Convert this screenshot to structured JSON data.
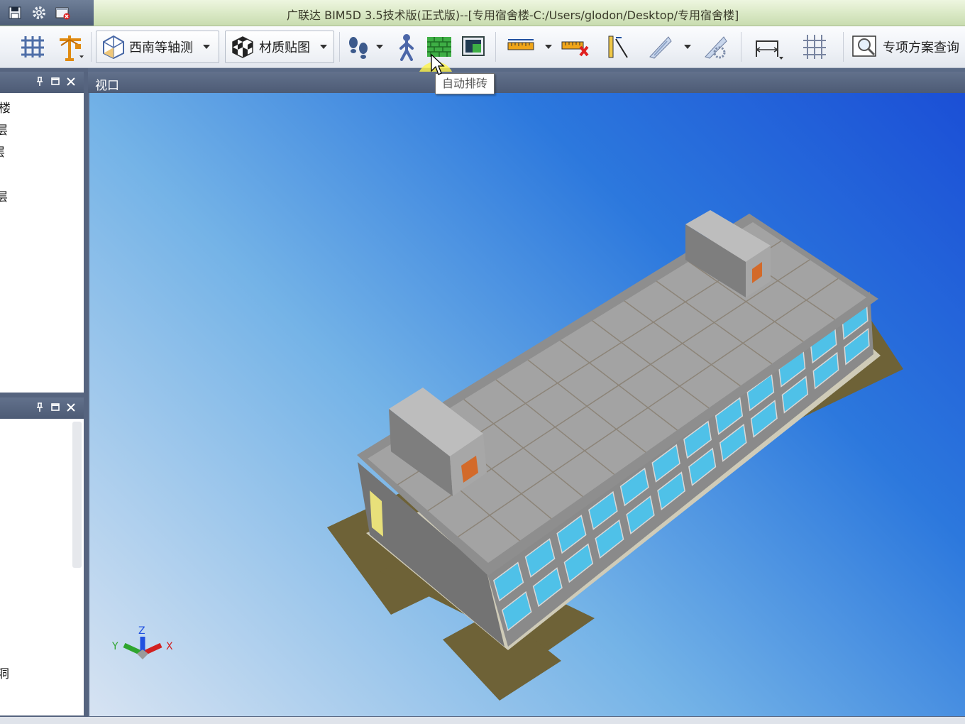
{
  "title_bar": {
    "title": "广联达 BIM5D 3.5技术版(正式版)--[专用宿舍楼-C:/Users/glodon/Desktop/专用宿舍楼]"
  },
  "quick_access": [
    "save-icon",
    "settings-gear-icon",
    "close-project-icon"
  ],
  "toolbar": {
    "view_mode_label": "西南等轴测",
    "material_label": "材质贴图",
    "special_query_label": "专项方案查询"
  },
  "tooltip": {
    "text": "自动排砖"
  },
  "left_panel_top": {
    "items": [
      "楼",
      "层",
      "层",
      "层"
    ]
  },
  "left_panel_bottom": {
    "items": [
      "洞"
    ]
  },
  "viewport": {
    "title": "视口",
    "axis_labels": {
      "x": "X",
      "y": "Y",
      "z": "Z"
    }
  },
  "colors": {
    "panel_header": "#56647f",
    "viewport_top_right": "#1b4fd6",
    "viewport_bottom_left": "#d7e3f2",
    "building_roof": "#9d9d9d",
    "ground_plane": "#6e6237",
    "window_glass": "#4fc1e8"
  }
}
